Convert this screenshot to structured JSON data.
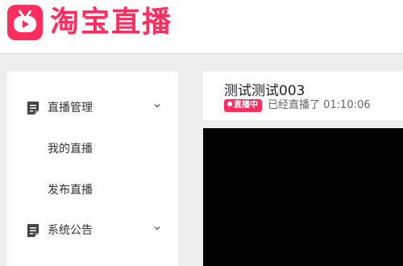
{
  "brand": {
    "name": "淘宝直播",
    "color": "#ff2e5f"
  },
  "sidebar": {
    "items": [
      {
        "label": "直播管理",
        "icon": "document-icon",
        "expanded": true
      },
      {
        "label": "我的直播",
        "sub": true
      },
      {
        "label": "发布直播",
        "sub": true
      },
      {
        "label": "系统公告",
        "icon": "document-icon",
        "expanded": false
      }
    ]
  },
  "stream": {
    "title": "测试测试003",
    "badge": "直播中",
    "elapsed": "已经直播了 01:10:06"
  }
}
